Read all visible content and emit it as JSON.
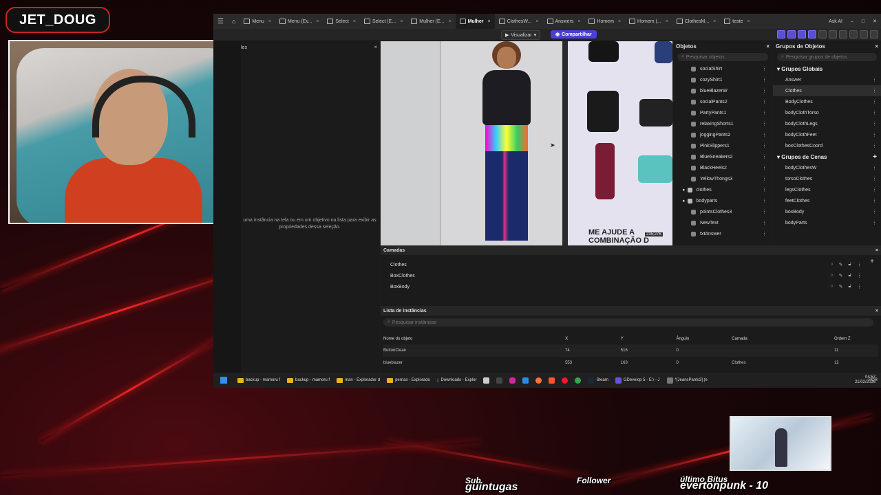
{
  "stream": {
    "channel_name": "JET_DOUG",
    "overlays": {
      "sub_label": "Sub.",
      "sub_value": "guintugas",
      "follower_label": "Follower",
      "follower_value": "",
      "bits_label": "último Bitus",
      "bits_value": "evertonpunk - 10"
    }
  },
  "app": {
    "tabs": [
      {
        "label": "Menu",
        "active": false
      },
      {
        "label": "Menu (Ev...",
        "active": false
      },
      {
        "label": "Select",
        "active": false
      },
      {
        "label": "Select (E...",
        "active": false
      },
      {
        "label": "Mulher (E...",
        "active": false
      },
      {
        "label": "Mulher",
        "active": true
      },
      {
        "label": "ClothesW...",
        "active": false
      },
      {
        "label": "Answers",
        "active": false
      },
      {
        "label": "Homem",
        "active": false
      },
      {
        "label": "Homem (...",
        "active": false
      },
      {
        "label": "ClothesM...",
        "active": false
      },
      {
        "label": "teste",
        "active": false
      }
    ],
    "user": "Ask AI",
    "toolbar": {
      "preview_label": "Visualizar",
      "share_label": "Compartilhar"
    },
    "properties": {
      "title": "les",
      "hint": "uma instância na tela ou em um objetivo na lista para exibir as propriedades dessa seleção."
    },
    "canvas": {
      "overlay_text": "ME AJUDE A COMBINAÇÃO D",
      "coord_readout": "235;276"
    },
    "objects": {
      "title": "Objetos",
      "search_placeholder": "Pesquisar objetos",
      "items": [
        {
          "label": "socialShirt",
          "kind": "object"
        },
        {
          "label": "cozyShirt1",
          "kind": "object"
        },
        {
          "label": "blueBlazerW",
          "kind": "object"
        },
        {
          "label": "socialPants2",
          "kind": "object"
        },
        {
          "label": "PartyPants1",
          "kind": "object"
        },
        {
          "label": "relaxingShorts1",
          "kind": "object"
        },
        {
          "label": "joggingPants2",
          "kind": "object"
        },
        {
          "label": "PinkSlippers1",
          "kind": "object"
        },
        {
          "label": "BlueSneakers2",
          "kind": "object"
        },
        {
          "label": "BlackHeels2",
          "kind": "object"
        },
        {
          "label": "YellowThongs3",
          "kind": "object"
        },
        {
          "label": "clothes",
          "kind": "folder"
        },
        {
          "label": "bodyparts",
          "kind": "folder"
        },
        {
          "label": "pointsClothes3",
          "kind": "object"
        },
        {
          "label": "NewText",
          "kind": "object"
        },
        {
          "label": "txtAnswer",
          "kind": "object"
        }
      ]
    },
    "groups": {
      "title": "Grupos de Objetos",
      "search_placeholder": "Pesquisar grupos de objetos",
      "global_header": "Grupos Globais",
      "global_items": [
        "Answer",
        "Clothes",
        "BodyClothes",
        "bodyClothTorso",
        "bodyClothLegs",
        "bodyClothFeet",
        "boxClothesCoord"
      ],
      "selected_global": "Clothes",
      "scene_header": "Grupos de Cenas",
      "scene_items": [
        "bodyClothesW",
        "torsoClothes",
        "legsClothes",
        "feetClothes",
        "boxBody",
        "bodyParts"
      ]
    },
    "layers": {
      "title": "Camadas",
      "items": [
        "Clothes",
        "BoxClothes",
        "BoxBody"
      ]
    },
    "instances": {
      "title": "Lista de instâncias",
      "search_placeholder": "Pesquisar instâncias",
      "columns": [
        "Nome do objeto",
        "X",
        "Y",
        "Ângulo",
        "Camada",
        "Ordem Z"
      ],
      "rows": [
        [
          "ButtonClean",
          "74",
          "516",
          "0",
          "",
          "11"
        ],
        [
          "blueblazer",
          "553",
          "163",
          "0",
          "Clothes",
          "12"
        ]
      ]
    }
  },
  "taskbar": {
    "items": [
      {
        "label": "backup - mamoru f",
        "icon": "folder-icon"
      },
      {
        "label": "backup - mamoru f",
        "icon": "folder-icon"
      },
      {
        "label": "man - Explorador d",
        "icon": "folder-icon"
      },
      {
        "label": "pernas - Explorado",
        "icon": "folder-icon"
      },
      {
        "label": "Downloads - Explor",
        "icon": "download-icon"
      }
    ],
    "apps": [
      {
        "label": "Steam",
        "icon": "steam-icon"
      },
      {
        "label": "GDevelop 5 - E:\\ - J",
        "icon": "gdevelop-icon"
      },
      {
        "label": "*[JeansPants3] (e",
        "icon": "paint-icon"
      }
    ],
    "lang": "POR",
    "time": "04:57",
    "date": "21/02/2026"
  },
  "colors": {
    "accent": "#4b3fd6",
    "brand_red": "#cc2222"
  }
}
